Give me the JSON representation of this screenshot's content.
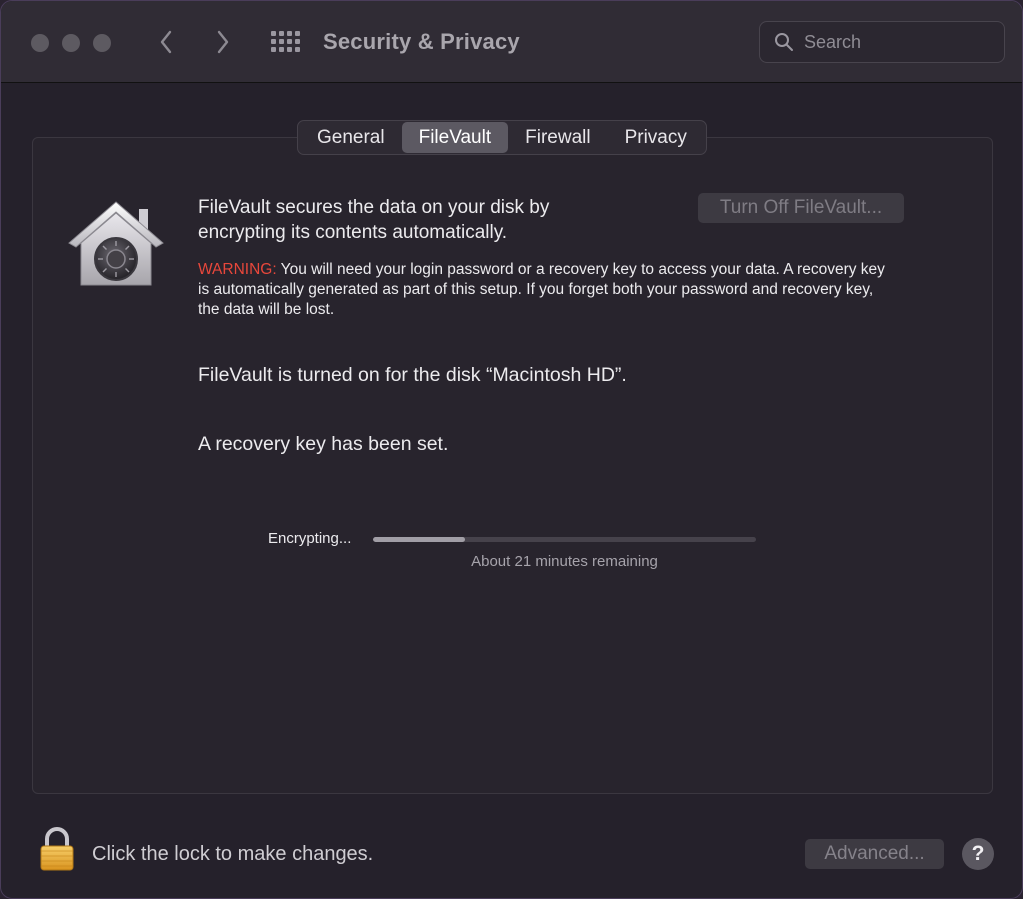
{
  "window": {
    "title": "Security & Privacy"
  },
  "toolbar": {
    "search_placeholder": "Search",
    "icons": [
      "chevron-left-icon",
      "chevron-right-icon",
      "grid-icon",
      "search-icon"
    ]
  },
  "tabs": [
    {
      "label": "General",
      "active": false
    },
    {
      "label": "FileVault",
      "active": true
    },
    {
      "label": "Firewall",
      "active": false
    },
    {
      "label": "Privacy",
      "active": false
    }
  ],
  "filevault": {
    "description": "FileVault secures the data on your disk by encrypting its contents automatically.",
    "turn_off_label": "Turn Off FileVault...",
    "warning_label": "WARNING:",
    "warning_text": " You will need your login password or a recovery key to access your data. A recovery key is automatically generated as part of this setup. If you forget both your password and recovery key, the data will be lost.",
    "status_disk": "FileVault is turned on for the disk “Macintosh HD”.",
    "status_recovery": "A recovery key has been set.",
    "encrypting_label": "Encrypting...",
    "progress_fraction": 0.24,
    "remaining_text": "About 21 minutes remaining"
  },
  "footer": {
    "lock_text": "Click the lock to make changes.",
    "advanced_label": "Advanced...",
    "help_label": "?"
  },
  "colors": {
    "warning": "#e8473b",
    "active_tab": "#5c5962",
    "window_bg": "#25212b"
  }
}
